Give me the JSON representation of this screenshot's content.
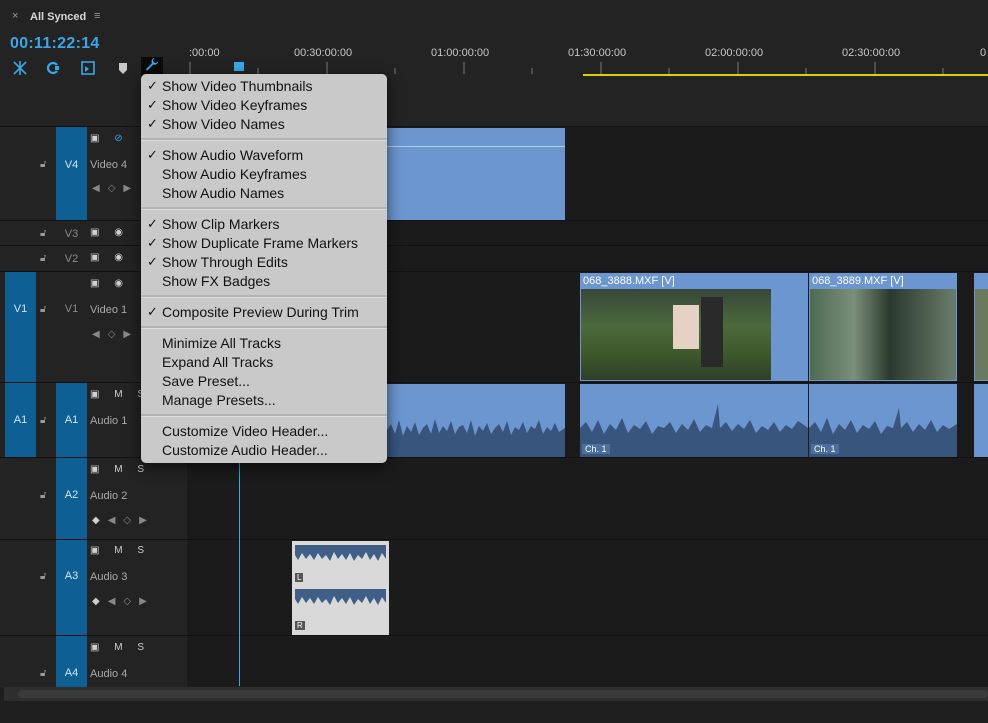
{
  "tab": {
    "title": "All Synced",
    "close_glyph": "×",
    "menu_glyph": "≡"
  },
  "timecode": "00:11:22:14",
  "toolbar": {
    "icons": [
      "snap-icon",
      "linked-selection-icon",
      "insert-nest-icon",
      "add-marker-icon",
      "wrench-icon"
    ],
    "accent": "#3aa7e8"
  },
  "ruler": {
    "labels": [
      ":00:00",
      "00:30:00:00",
      "01:00:00:00",
      "01:30:00:00",
      "02:00:00:00",
      "02:30:00:00",
      "0"
    ]
  },
  "tracks": {
    "v4": {
      "target": "V4",
      "name": "Video 4"
    },
    "v3": {
      "target": "V3"
    },
    "v2": {
      "target": "V2"
    },
    "v1": {
      "source": "V1",
      "target": "V1",
      "name": "Video 1"
    },
    "a1": {
      "source": "A1",
      "target": "A1",
      "name": "Audio 1",
      "m": "M",
      "s": "S"
    },
    "a2": {
      "target": "A2",
      "name": "Audio 2",
      "m": "M",
      "s": "S"
    },
    "a3": {
      "target": "A3",
      "name": "Audio 3",
      "m": "M",
      "s": "S"
    },
    "a4": {
      "target": "A4",
      "name": "Audio 4",
      "m": "M",
      "s": "S"
    }
  },
  "clips": {
    "v1_clip1": "068_3888.MXF [V]",
    "v1_clip2": "068_3889.MXF [V]",
    "a1_ch1": "Ch. 1",
    "a1_ch2": "Ch. 1",
    "a3_l": "L",
    "a3_r": "R"
  },
  "menu": {
    "items": [
      {
        "label": "Show Video Thumbnails",
        "checked": true
      },
      {
        "label": "Show Video Keyframes",
        "checked": true
      },
      {
        "label": "Show Video Names",
        "checked": true
      },
      {
        "label": "Show Audio Waveform",
        "checked": true
      },
      {
        "label": "Show Audio Keyframes",
        "checked": false
      },
      {
        "label": "Show Audio Names",
        "checked": false
      },
      {
        "label": "Show Clip Markers",
        "checked": true
      },
      {
        "label": "Show Duplicate Frame Markers",
        "checked": true
      },
      {
        "label": "Show Through Edits",
        "checked": true
      },
      {
        "label": "Show FX Badges",
        "checked": false
      },
      {
        "label": "Composite Preview During Trim",
        "checked": true
      },
      {
        "label": "Minimize All Tracks",
        "checked": false
      },
      {
        "label": "Expand All Tracks",
        "checked": false
      },
      {
        "label": "Save Preset...",
        "checked": false
      },
      {
        "label": "Manage Presets...",
        "checked": false
      },
      {
        "label": "Customize Video Header...",
        "checked": false
      },
      {
        "label": "Customize Audio Header...",
        "checked": false
      }
    ],
    "check_glyph": "✓"
  }
}
